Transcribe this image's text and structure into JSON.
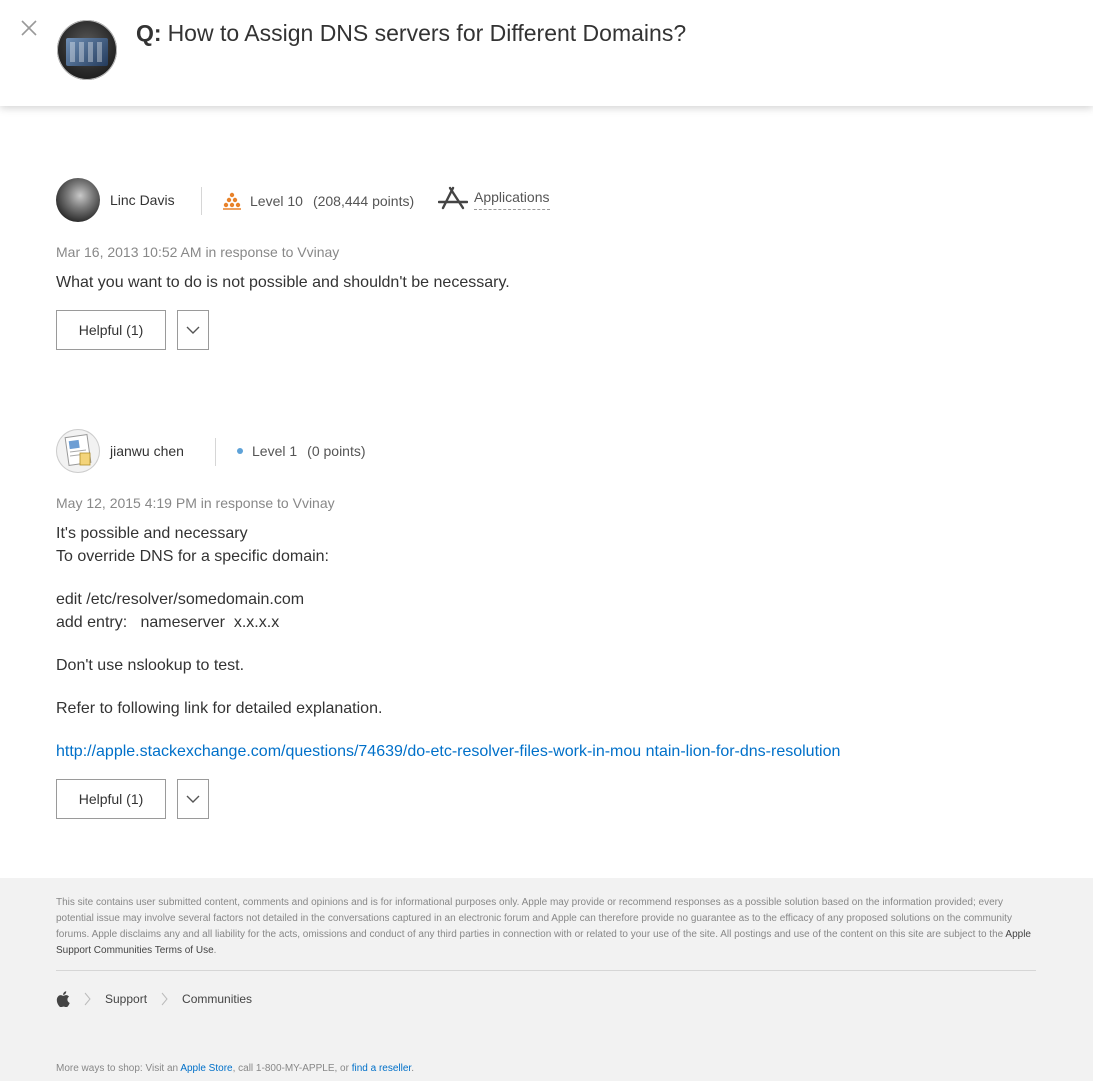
{
  "header": {
    "question_prefix": "Q:",
    "question_title": "How to Assign DNS servers for Different Domains?"
  },
  "posts": [
    {
      "author": "Linc Davis",
      "level": "Level 10",
      "points": "(208,444 points)",
      "badge": "Applications",
      "date": "Mar 16, 2013 10:52 AM",
      "in_response": "in response to Vvinay",
      "body": [
        "What you want to do is not possible and shouldn't be necessary."
      ],
      "helpful_label": "Helpful (1)"
    },
    {
      "author": "jianwu chen",
      "level": "Level 1",
      "points": "(0 points)",
      "date": "May 12, 2015 4:19 PM",
      "in_response": "in response to Vvinay",
      "body": [
        "It's possible and necessary",
        "To override DNS for a specific domain:",
        "edit /etc/resolver/somedomain.com",
        "add entry:   nameserver  x.x.x.x",
        "Don't use nslookup to test.",
        "Refer to following link for detailed explanation."
      ],
      "link": "http://apple.stackexchange.com/questions/74639/do-etc-resolver-files-work-in-mou ntain-lion-for-dns-resolution",
      "helpful_label": "Helpful (1)"
    }
  ],
  "footer": {
    "disclaimer": "This site contains user submitted content, comments and opinions and is for informational purposes only. Apple may provide or recommend responses as a possible solution based on the information provided; every potential issue may involve several factors not detailed in the conversations captured in an electronic forum and Apple can therefore provide no guarantee as to the efficacy of any proposed solutions on the community forums. Apple disclaims any and all liability for the acts, omissions and conduct of any third parties in connection with or related to your use of the site. All postings and use of the content on this site are subject to the ",
    "terms_link": "Apple Support Communities Terms of Use",
    "breadcrumb": [
      "Support",
      "Communities"
    ],
    "shop_prefix": "More ways to shop: Visit an ",
    "apple_store": "Apple Store",
    "shop_middle": ", call 1-800-MY-APPLE, or ",
    "find_reseller": "find a reseller"
  },
  "colors": {
    "link": "#0070c9",
    "level10_badge": "#e8822a",
    "level1_dot": "#5ea2d8"
  },
  "icons": [
    "close-icon",
    "apple-logo-icon",
    "app-store-icon",
    "chevron-down-icon",
    "level-pyramid-icon",
    "level-dot-icon"
  ]
}
